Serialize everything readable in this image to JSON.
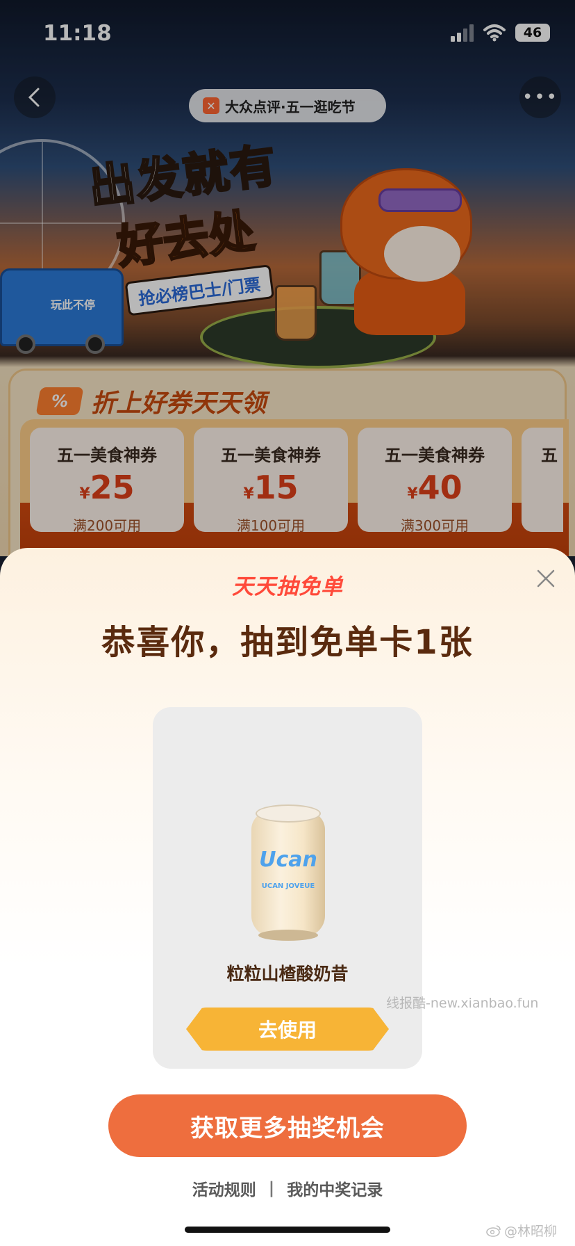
{
  "status_bar": {
    "time": "11:18",
    "battery": "46"
  },
  "background_page": {
    "brand_pill": "大众点评·五一逛吃节",
    "headline_line1": "出发就有",
    "headline_line2": "好去处",
    "headline_tag": "抢必榜巴士/门票",
    "bus_text": "玩此不停",
    "coupon_section_title": "折上好券天天领",
    "coupon_badge": "%",
    "coupons": [
      {
        "name": "五一美食神券",
        "currency": "¥",
        "amount": "25",
        "condition": "满200可用"
      },
      {
        "name": "五一美食神券",
        "currency": "¥",
        "amount": "15",
        "condition": "满100可用"
      },
      {
        "name": "五一美食神券",
        "currency": "¥",
        "amount": "40",
        "condition": "满300可用"
      },
      {
        "name": "五",
        "currency": "",
        "amount": "",
        "condition": ""
      }
    ]
  },
  "sheet": {
    "brand": "天天抽免单",
    "title": "恭喜你，抽到免单卡1张",
    "prize": {
      "can_logo": "Ucan",
      "can_sub": "UCAN JOVEUE",
      "name": "粒粒山楂酸奶昔",
      "use_label": "去使用"
    },
    "watermark": "线报酷-new.xianbao.fun",
    "more_chances_label": "获取更多抽奖机会",
    "rules_link": "活动规则",
    "separator": "|",
    "records_link": "我的中奖记录"
  },
  "credit": "@林昭柳",
  "colors": {
    "accent_orange": "#ee6e3e",
    "use_button": "#f7b436",
    "title_brown": "#5a2a0e",
    "brand_red": "#ff4a3a"
  },
  "icons": [
    "back-icon",
    "more-icon",
    "close-icon",
    "wifi-icon",
    "signal-icon",
    "battery-icon",
    "weibo-icon"
  ]
}
